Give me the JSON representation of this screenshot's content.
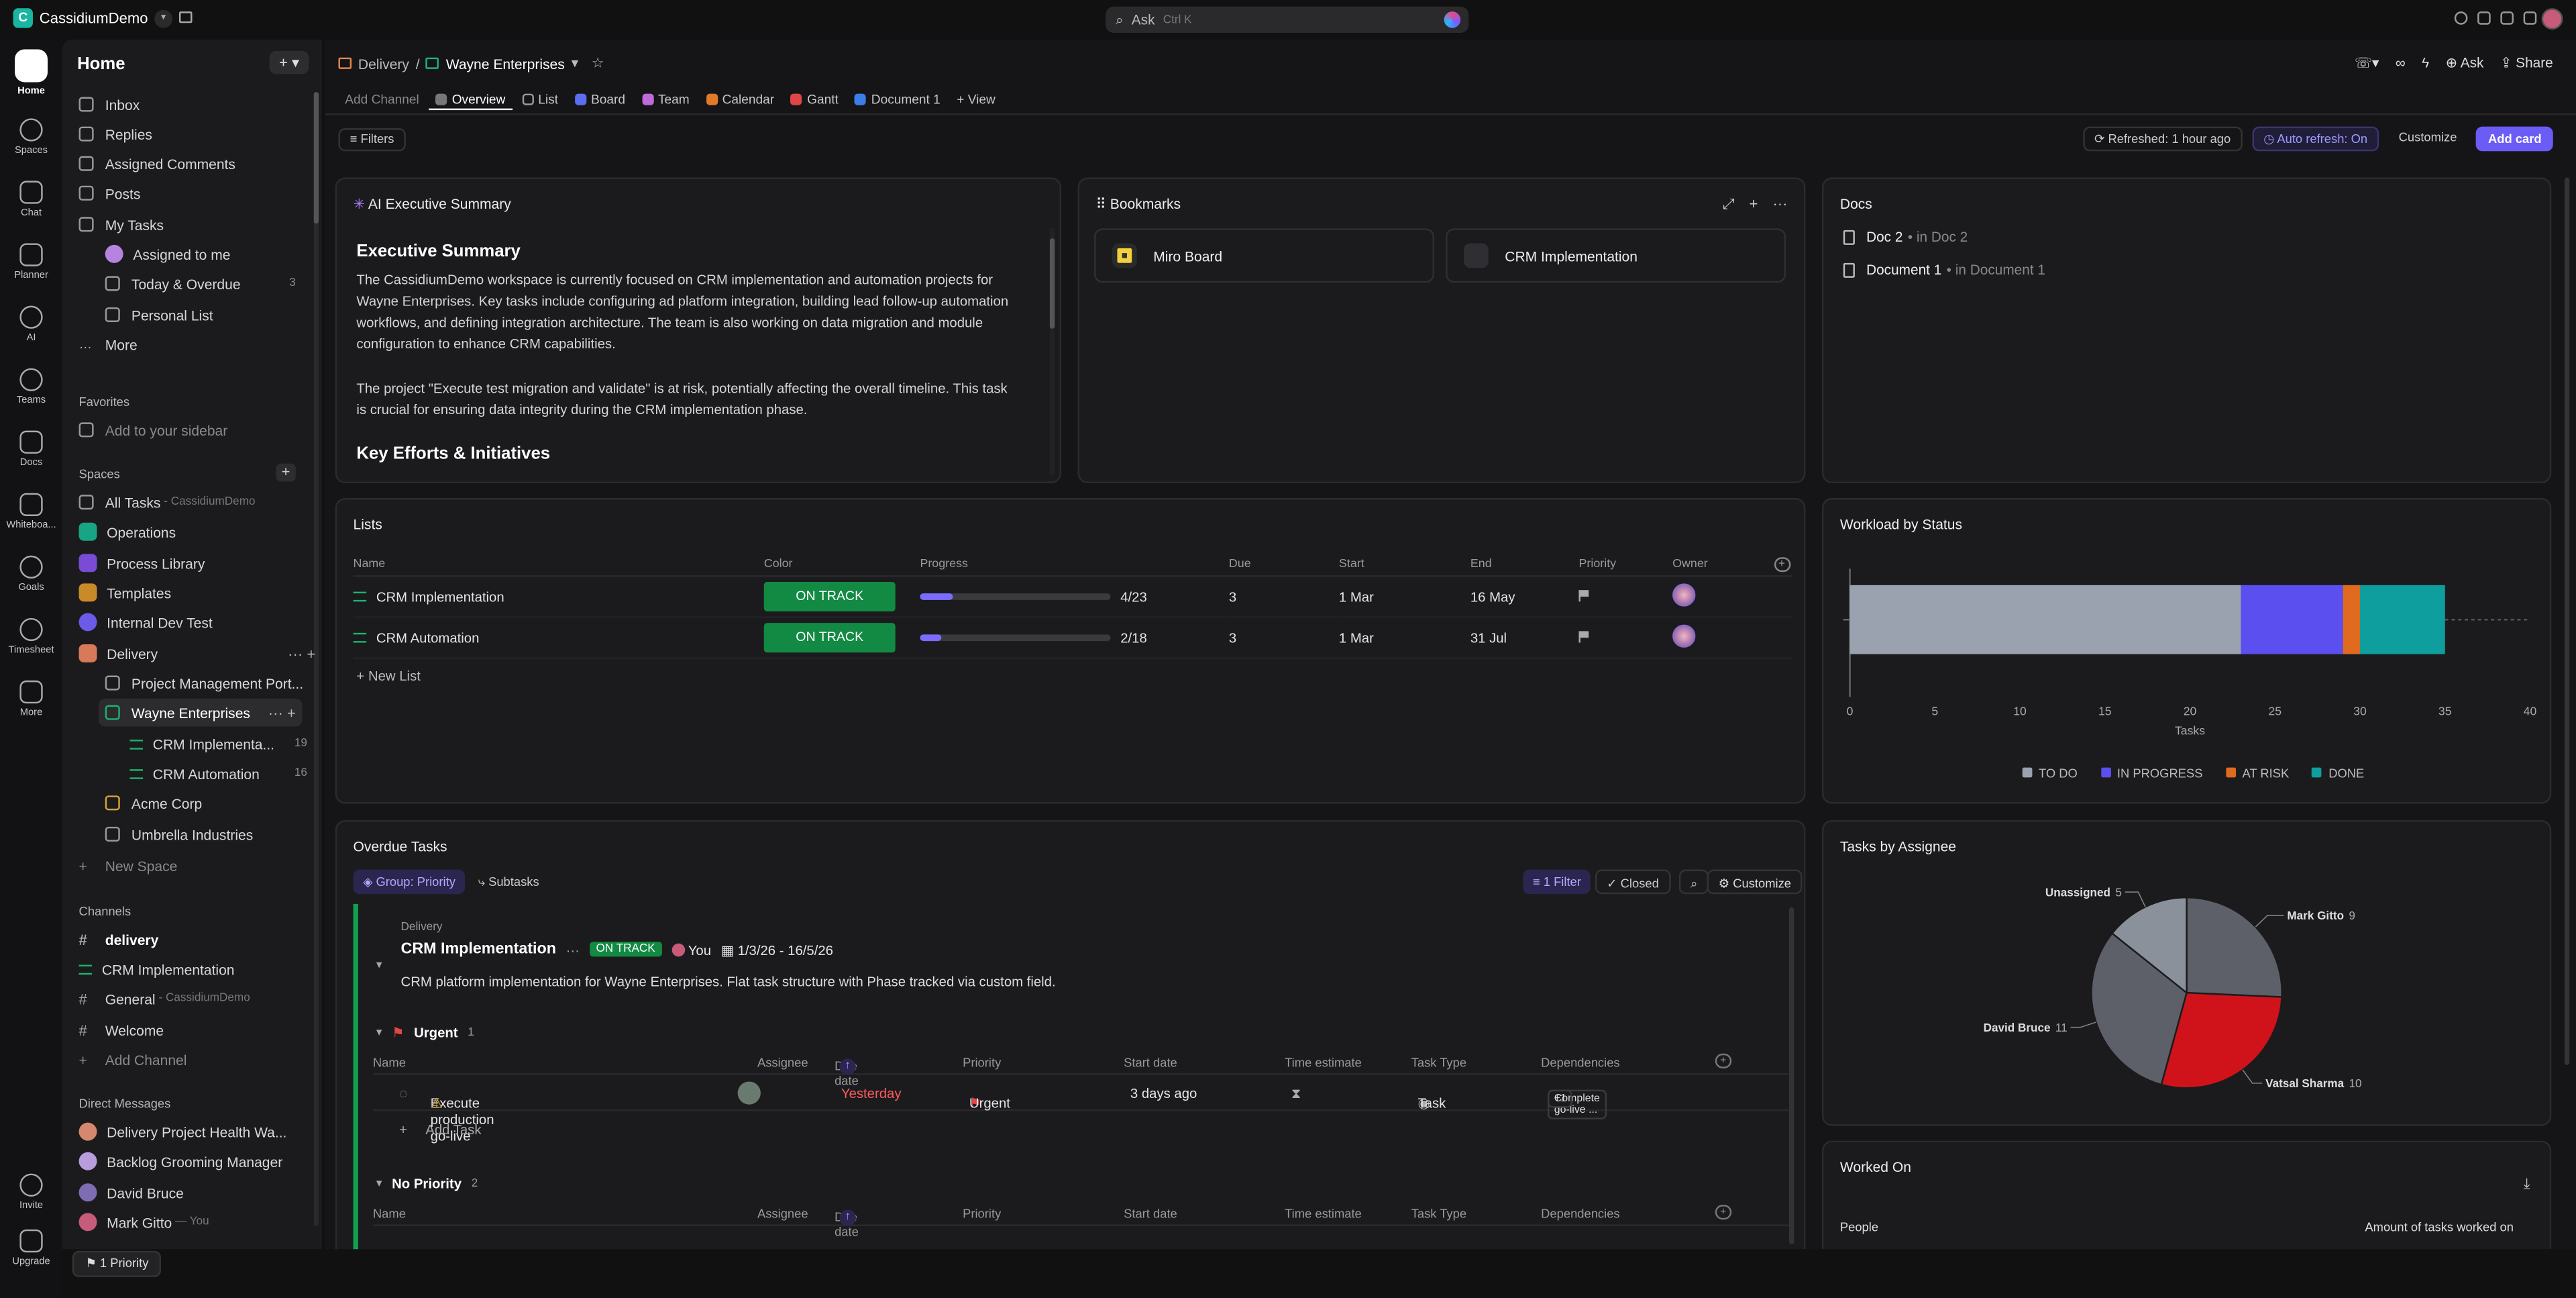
{
  "topbar": {
    "workspace_initial": "C",
    "workspace_name": "CassidiumDemo",
    "search_placeholder": "Ask",
    "search_shortcut": "Ctrl K"
  },
  "rail": [
    {
      "label": "Home",
      "icon": "home-icon"
    },
    {
      "label": "Spaces",
      "icon": "spaces-icon"
    },
    {
      "label": "Chat",
      "icon": "chat-icon"
    },
    {
      "label": "Planner",
      "icon": "planner-icon"
    },
    {
      "label": "AI",
      "icon": "ai-icon"
    },
    {
      "label": "Teams",
      "icon": "teams-icon"
    },
    {
      "label": "Docs",
      "icon": "docs-icon"
    },
    {
      "label": "Whiteboa...",
      "icon": "whiteboard-icon"
    },
    {
      "label": "Goals",
      "icon": "goals-icon"
    },
    {
      "label": "Timesheet",
      "icon": "timesheet-icon"
    },
    {
      "label": "More",
      "icon": "more-grid-icon"
    },
    {
      "label": "Invite",
      "icon": "invite-icon"
    },
    {
      "label": "Upgrade",
      "icon": "upgrade-icon"
    }
  ],
  "sidebar": {
    "title": "Home",
    "nav": [
      "Inbox",
      "Replies",
      "Assigned Comments",
      "Posts",
      "My Tasks",
      "Assigned to me",
      "Today & Overdue",
      "Personal List",
      "More"
    ],
    "today_count": "3",
    "favorites_header": "Favorites",
    "favorites_placeholder": "Add to your sidebar",
    "spaces_header": "Spaces",
    "all_tasks": "All Tasks",
    "all_tasks_sub": "- CassidiumDemo",
    "spaces": [
      "Operations",
      "Process Library",
      "Templates",
      "Internal Dev Test",
      "Delivery"
    ],
    "folders": [
      "Project Management Port...",
      "Wayne Enterprises"
    ],
    "lists": [
      {
        "name": "CRM Implementa...",
        "count": "19"
      },
      {
        "name": "CRM Automation",
        "count": "16"
      }
    ],
    "folders2": [
      "Acme Corp",
      "Umbrella Industries"
    ],
    "new_space": "New Space",
    "channels_header": "Channels",
    "channels": [
      "delivery",
      "CRM Implementation",
      "General",
      "Welcome"
    ],
    "general_sub": "- CassidiumDemo",
    "add_channel": "Add Channel",
    "dm_header": "Direct Messages",
    "dms": [
      "Delivery Project Health Wa...",
      "Backlog Grooming Manager",
      "David Bruce",
      "Mark Gitto"
    ],
    "dm_you": "— You"
  },
  "bottom_pill": "1 Priority",
  "main": {
    "breadcrumb": [
      "Delivery",
      "/",
      "Wayne Enterprises"
    ],
    "actions": [
      "Ask",
      "Share"
    ],
    "tabs": [
      "Add Channel",
      "Overview",
      "List",
      "Board",
      "Team",
      "Calendar",
      "Gantt",
      "Document 1",
      "+ View"
    ],
    "filters": "Filters",
    "refreshed": "Refreshed: 1 hour ago",
    "auto_refresh": "Auto refresh: On",
    "customize": "Customize",
    "add_card": "Add card"
  },
  "ai_summary": {
    "title": "AI Executive Summary",
    "heading": "Executive Summary",
    "p1": "The CassidiumDemo workspace is currently focused on CRM implementation and automation projects for Wayne Enterprises. Key tasks include configuring ad platform integration, building lead follow-up automation workflows, and defining integration architecture. The team is also working on data migration and module configuration to enhance CRM capabilities.",
    "p2": "The project \"Execute test migration and validate\" is at risk, potentially affecting the overall timeline. This task is crucial for ensuring data integrity during the CRM implementation phase.",
    "heading2": "Key Efforts & Initiatives"
  },
  "bookmarks": {
    "title": "Bookmarks",
    "items": [
      "Miro Board",
      "CRM Implementation"
    ]
  },
  "docs": {
    "title": "Docs",
    "items": [
      {
        "name": "Doc 2",
        "loc": "• in Doc 2"
      },
      {
        "name": "Document 1",
        "loc": "• in Document 1"
      }
    ]
  },
  "lists_card": {
    "title": "Lists",
    "columns": [
      "Name",
      "Color",
      "Progress",
      "Due",
      "Start",
      "End",
      "Priority",
      "Owner"
    ],
    "rows": [
      {
        "name": "CRM Implementation",
        "status": "ON TRACK",
        "progress": "4/23",
        "progress_frac": 0.174,
        "due": "3",
        "start": "1 Mar",
        "end": "16 May"
      },
      {
        "name": "CRM Automation",
        "status": "ON TRACK",
        "progress": "2/18",
        "progress_frac": 0.111,
        "due": "3",
        "start": "1 Mar",
        "end": "31 Jul"
      }
    ],
    "new_list": "New List"
  },
  "workload": {
    "title": "Workload by Status",
    "xlabel": "Tasks",
    "ticks": [
      "0",
      "5",
      "10",
      "15",
      "20",
      "25",
      "30",
      "35",
      "40"
    ],
    "legend": [
      "TO DO",
      "IN PROGRESS",
      "AT RISK",
      "DONE"
    ]
  },
  "overdue": {
    "title": "Overdue Tasks",
    "group": "Group: Priority",
    "subtasks": "Subtasks",
    "filter": "1 Filter",
    "closed": "Closed",
    "customize": "Customize",
    "location": "Delivery",
    "list_name": "CRM Implementation",
    "status": "ON TRACK",
    "owner": "You",
    "dates": "1/3/26 - 16/5/26",
    "desc": "CRM platform implementation for Wayne Enterprises. Flat task structure with Phase tracked via custom field.",
    "groups": [
      {
        "name": "Urgent",
        "count": "1"
      },
      {
        "name": "No Priority",
        "count": "2"
      }
    ],
    "columns": [
      "Name",
      "Assignee",
      "Due date",
      "Priority",
      "Start date",
      "Time estimate",
      "Task Type",
      "Dependencies"
    ],
    "task": {
      "name": "Execute production go-live",
      "due": "Yesterday",
      "priority": "Urgent",
      "start": "3 days ago",
      "type": "Task",
      "dep": "Complete go-live ...",
      "dep_more": "+1"
    },
    "add_task": "Add Task"
  },
  "assignee_chart": {
    "title": "Tasks by Assignee"
  },
  "worked_on": {
    "title": "Worked On",
    "col1": "People",
    "col2": "Amount of tasks worked on"
  },
  "chart_data": [
    {
      "type": "bar",
      "title": "Workload by Status",
      "orientation": "horizontal-stacked",
      "xlabel": "Tasks",
      "xlim": [
        0,
        40
      ],
      "series": [
        {
          "name": "TO DO",
          "values": [
            23
          ],
          "color": "#9aa2af"
        },
        {
          "name": "IN PROGRESS",
          "values": [
            6
          ],
          "color": "#5b4ff0"
        },
        {
          "name": "AT RISK",
          "values": [
            1
          ],
          "color": "#e06b1f"
        },
        {
          "name": "DONE",
          "values": [
            5
          ],
          "color": "#0f9e9e"
        }
      ],
      "legend": "bottom"
    },
    {
      "type": "pie",
      "title": "Tasks by Assignee",
      "labels": [
        "Mark Gitto",
        "Vatsal Sharma",
        "David Bruce",
        "Unassigned"
      ],
      "values": [
        9,
        10,
        11,
        5
      ],
      "colors": [
        "#5d6068",
        "#d0131a",
        "#5d6068",
        "#8b919b"
      ]
    }
  ]
}
